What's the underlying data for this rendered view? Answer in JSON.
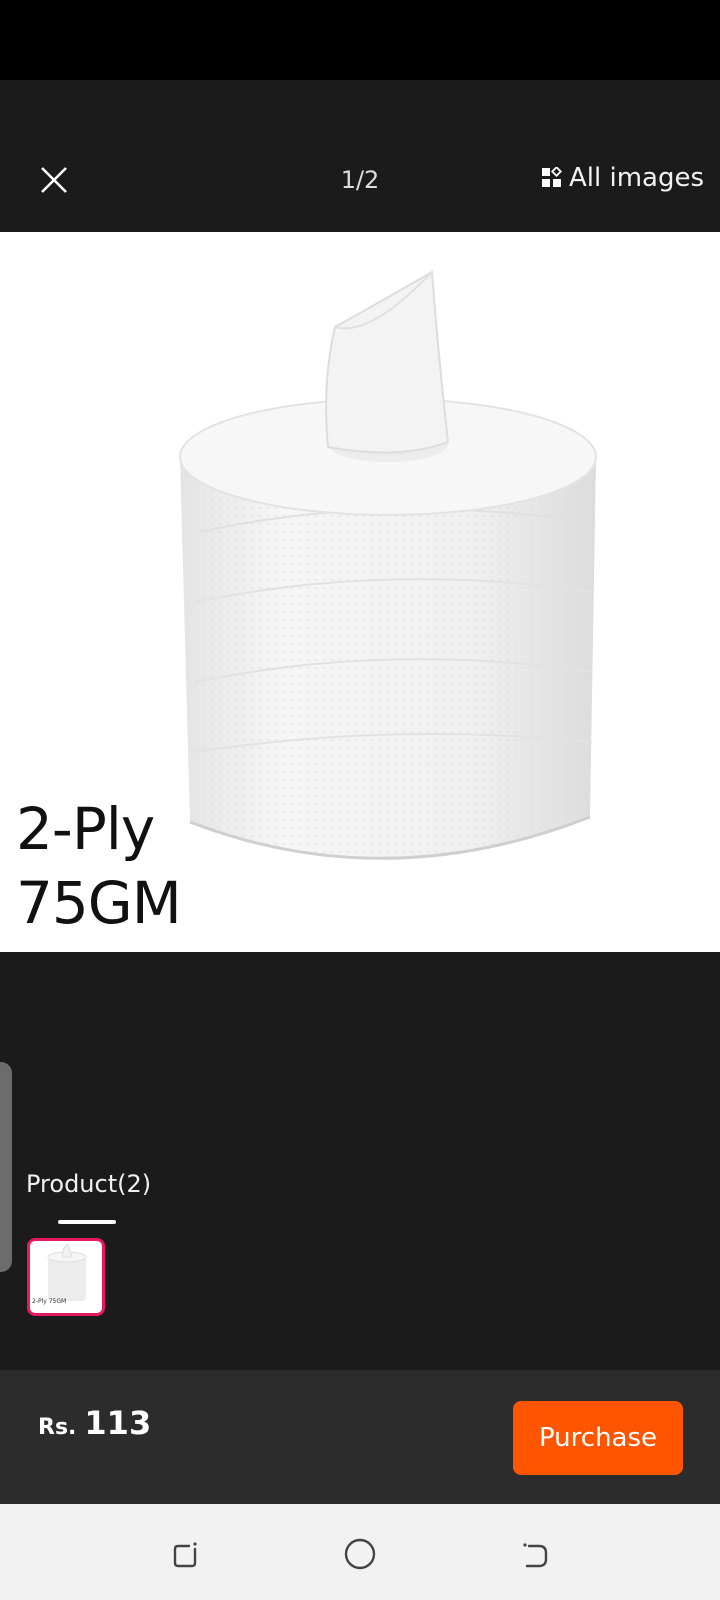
{
  "header": {
    "counter": "1/2",
    "all_images_label": "All images"
  },
  "product_image": {
    "caption_line1": "2-Ply",
    "caption_line2": "75GM"
  },
  "tabs": [
    {
      "label": "Product(2)",
      "selected": true
    }
  ],
  "thumbnail": {
    "caption": "2-Ply 75GM"
  },
  "bottom_bar": {
    "currency": "Rs.",
    "price": "113",
    "purchase_label": "Purchase"
  },
  "colors": {
    "accent": "#ff5500",
    "thumbnail_border": "#e6185f",
    "header_bg": "#1b1b1b",
    "bottom_bar_bg": "#2c2c2c"
  },
  "icons": {
    "close": "close-icon",
    "all_images": "grid-icon",
    "nav_recents": "recents-icon",
    "nav_home": "home-icon",
    "nav_back": "back-icon"
  }
}
